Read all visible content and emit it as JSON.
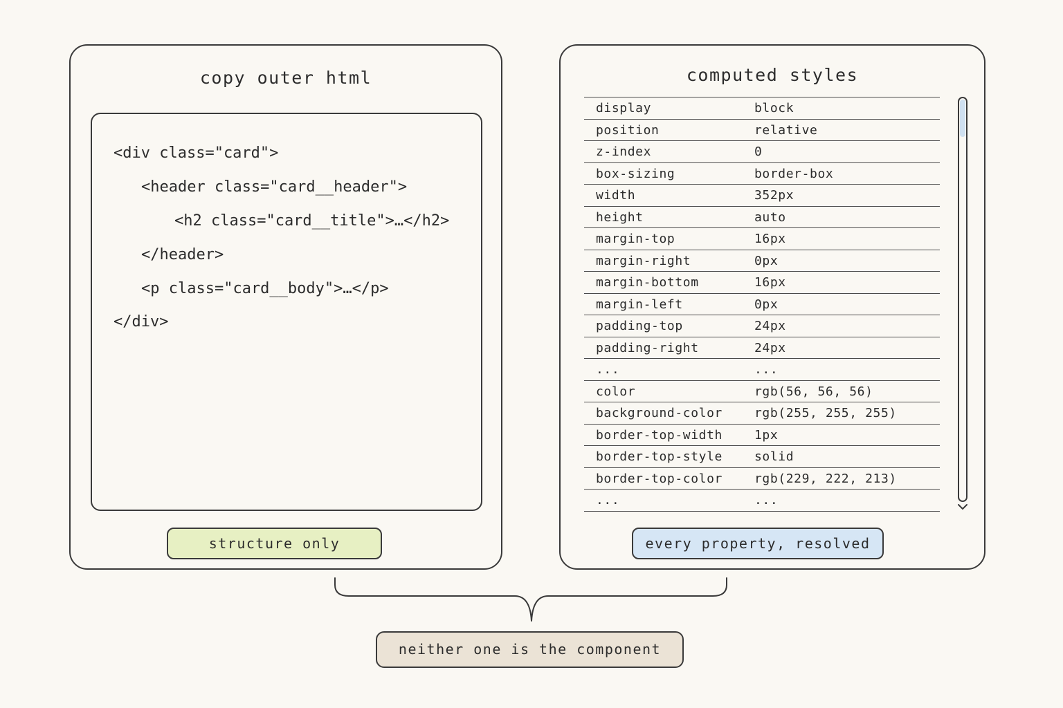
{
  "left_panel": {
    "title": "copy outer html",
    "code_lines": [
      "<div class=\"card\">",
      "<header class=\"card__header\">",
      "<h2 class=\"card__title\">…</h2>",
      "</header>",
      "<p class=\"card__body\">…</p>",
      "</div>"
    ],
    "badge": "structure only"
  },
  "right_panel": {
    "title": "computed styles",
    "rows": [
      {
        "prop": "display",
        "value": "block"
      },
      {
        "prop": "position",
        "value": "relative"
      },
      {
        "prop": "z-index",
        "value": "0"
      },
      {
        "prop": "box-sizing",
        "value": "border-box"
      },
      {
        "prop": "width",
        "value": "352px"
      },
      {
        "prop": "height",
        "value": "auto"
      },
      {
        "prop": "margin-top",
        "value": "16px"
      },
      {
        "prop": "margin-right",
        "value": "0px"
      },
      {
        "prop": "margin-bottom",
        "value": "16px"
      },
      {
        "prop": "margin-left",
        "value": "0px"
      },
      {
        "prop": "padding-top",
        "value": "24px"
      },
      {
        "prop": "padding-right",
        "value": "24px"
      },
      {
        "prop": "...",
        "value": "..."
      },
      {
        "prop": "color",
        "value": "rgb(56, 56, 56)"
      },
      {
        "prop": "background-color",
        "value": "rgb(255, 255, 255)"
      },
      {
        "prop": "border-top-width",
        "value": "1px"
      },
      {
        "prop": "border-top-style",
        "value": "solid"
      },
      {
        "prop": "border-top-color",
        "value": "rgb(229, 222, 213)"
      },
      {
        "prop": "...",
        "value": "..."
      }
    ],
    "badge": "every property, resolved"
  },
  "conclusion": "neither one is the component",
  "colors": {
    "background": "#faf8f3",
    "stroke": "#3a3a3a",
    "structure_badge": "#e7f0c3",
    "resolved_badge": "#d6e6f5",
    "conclusion_badge": "#ebe3d6",
    "scroll_thumb": "#cfe0f0"
  }
}
